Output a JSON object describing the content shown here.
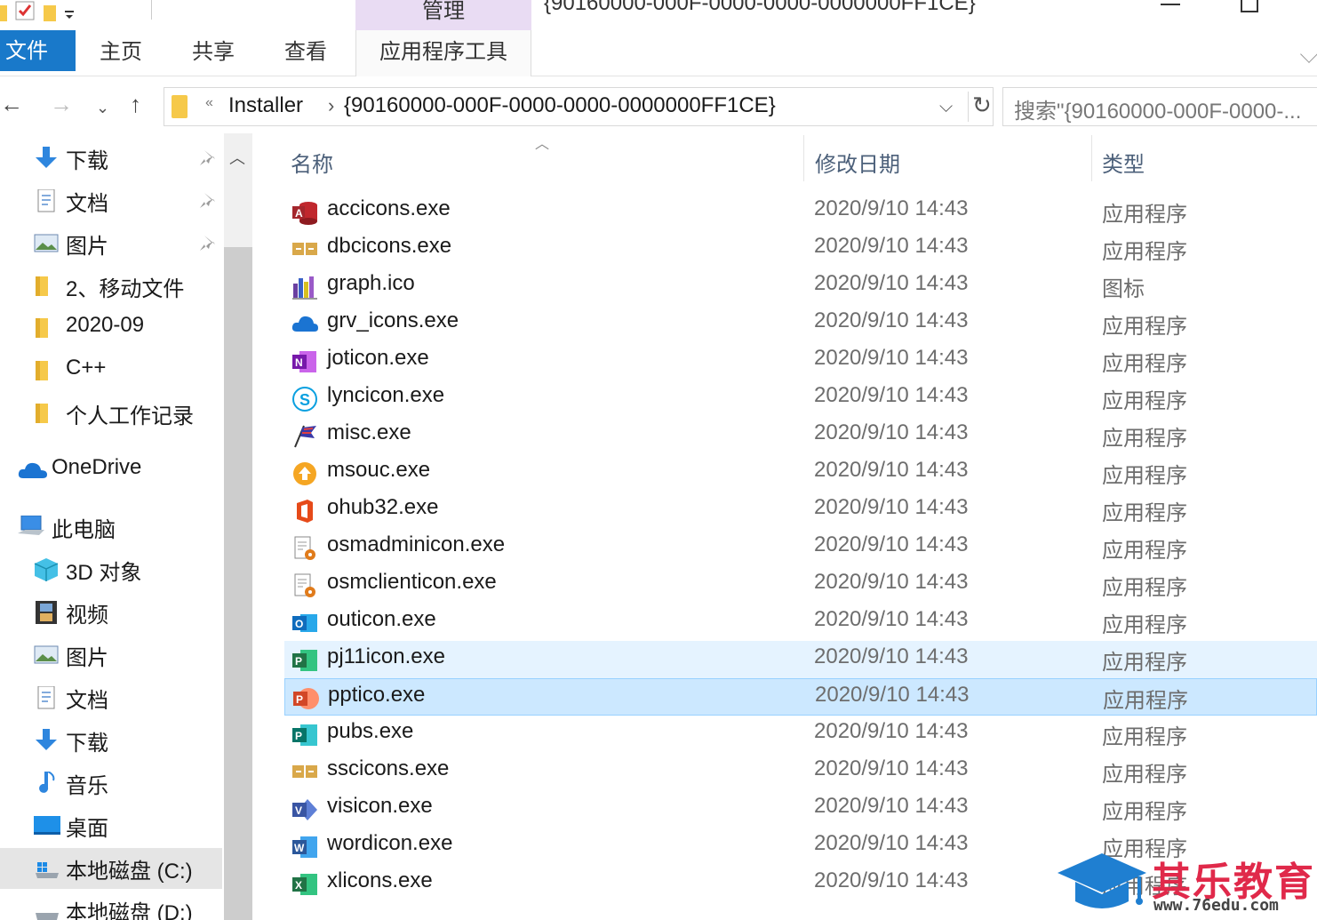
{
  "window": {
    "title": "{90160000-000F-0000-0000-0000000FF1CE}",
    "context_tab_group": "管理"
  },
  "ribbon": {
    "tabs": [
      {
        "label": "文件"
      },
      {
        "label": "主页"
      },
      {
        "label": "共享"
      },
      {
        "label": "查看"
      },
      {
        "label": "应用程序工具"
      }
    ]
  },
  "address": {
    "segments": [
      "Installer",
      "{90160000-000F-0000-0000-0000000FF1CE}"
    ],
    "overflow": "«",
    "separator": "›"
  },
  "search": {
    "placeholder": "搜索\"{90160000-000F-0000-..."
  },
  "nav": {
    "items": [
      {
        "label": "下载",
        "icon": "download-arrow-icon",
        "pinned": true
      },
      {
        "label": "文档",
        "icon": "document-icon",
        "pinned": true
      },
      {
        "label": "图片",
        "icon": "picture-icon",
        "pinned": true
      },
      {
        "label": "2、移动文件",
        "icon": "folder-icon",
        "pinned": false
      },
      {
        "label": "2020-09",
        "icon": "folder-icon",
        "pinned": false
      },
      {
        "label": "C++",
        "icon": "folder-icon",
        "pinned": false
      },
      {
        "label": "个人工作记录",
        "icon": "folder-icon",
        "pinned": false
      },
      {
        "label": "OneDrive",
        "icon": "onedrive-cloud-icon",
        "pinned": false
      },
      {
        "label": "此电脑",
        "icon": "this-pc-icon",
        "pinned": false
      },
      {
        "label": "3D 对象",
        "icon": "3d-objects-icon",
        "pinned": false
      },
      {
        "label": "视频",
        "icon": "video-icon",
        "pinned": false
      },
      {
        "label": "图片",
        "icon": "picture-icon",
        "pinned": false
      },
      {
        "label": "文档",
        "icon": "document-icon",
        "pinned": false
      },
      {
        "label": "下载",
        "icon": "download-arrow-icon",
        "pinned": false
      },
      {
        "label": "音乐",
        "icon": "music-note-icon",
        "pinned": false
      },
      {
        "label": "桌面",
        "icon": "desktop-icon",
        "pinned": false
      },
      {
        "label": "本地磁盘 (C:)",
        "icon": "windows-drive-icon",
        "pinned": false
      },
      {
        "label": "本地磁盘 (D:)",
        "icon": "drive-icon",
        "pinned": false
      }
    ]
  },
  "columns": {
    "name": "名称",
    "date": "修改日期",
    "type": "类型"
  },
  "files": [
    {
      "name": "accicons.exe",
      "date": "2020/9/10 14:43",
      "type": "应用程序",
      "icon": "access-icon",
      "color": "#c0272d"
    },
    {
      "name": "dbcicons.exe",
      "date": "2020/9/10 14:43",
      "type": "应用程序",
      "icon": "dbc-compare-icon",
      "color": "#d9a84a"
    },
    {
      "name": "graph.ico",
      "date": "2020/9/10 14:43",
      "type": "图标",
      "icon": "graph-bars-icon",
      "color": "#6a3fa0"
    },
    {
      "name": "grv_icons.exe",
      "date": "2020/9/10 14:43",
      "type": "应用程序",
      "icon": "onedrive-cloud-icon",
      "color": "#1b74d2"
    },
    {
      "name": "joticon.exe",
      "date": "2020/9/10 14:43",
      "type": "应用程序",
      "icon": "onenote-icon",
      "color": "#7719aa"
    },
    {
      "name": "lyncicon.exe",
      "date": "2020/9/10 14:43",
      "type": "应用程序",
      "icon": "skype-icon",
      "color": "#0aa0e0"
    },
    {
      "name": "misc.exe",
      "date": "2020/9/10 14:43",
      "type": "应用程序",
      "icon": "misc-flag-icon",
      "color": "#3a3aa8"
    },
    {
      "name": "msouc.exe",
      "date": "2020/9/10 14:43",
      "type": "应用程序",
      "icon": "upload-center-icon",
      "color": "#f5a623"
    },
    {
      "name": "ohub32.exe",
      "date": "2020/9/10 14:43",
      "type": "应用程序",
      "icon": "office-hub-icon",
      "color": "#e64a19"
    },
    {
      "name": "osmadminicon.exe",
      "date": "2020/9/10 14:43",
      "type": "应用程序",
      "icon": "doc-gear-icon",
      "color": "#e07b1b"
    },
    {
      "name": "osmclienticon.exe",
      "date": "2020/9/10 14:43",
      "type": "应用程序",
      "icon": "doc-gear-icon",
      "color": "#e07b1b"
    },
    {
      "name": "outicon.exe",
      "date": "2020/9/10 14:43",
      "type": "应用程序",
      "icon": "outlook-icon",
      "color": "#0f6cbd"
    },
    {
      "name": "pj11icon.exe",
      "date": "2020/9/10 14:43",
      "type": "应用程序",
      "icon": "project-icon",
      "color": "#217346"
    },
    {
      "name": "pptico.exe",
      "date": "2020/9/10 14:43",
      "type": "应用程序",
      "icon": "powerpoint-icon",
      "color": "#d24726"
    },
    {
      "name": "pubs.exe",
      "date": "2020/9/10 14:43",
      "type": "应用程序",
      "icon": "publisher-icon",
      "color": "#077568"
    },
    {
      "name": "sscicons.exe",
      "date": "2020/9/10 14:43",
      "type": "应用程序",
      "icon": "ssc-compare-icon",
      "color": "#d9a84a"
    },
    {
      "name": "visicon.exe",
      "date": "2020/9/10 14:43",
      "type": "应用程序",
      "icon": "visio-icon",
      "color": "#3955a3"
    },
    {
      "name": "wordicon.exe",
      "date": "2020/9/10 14:43",
      "type": "应用程序",
      "icon": "word-icon",
      "color": "#2b579a"
    },
    {
      "name": "xlicons.exe",
      "date": "2020/9/10 14:43",
      "type": "应用程序",
      "icon": "excel-icon",
      "color": "#217346"
    }
  ],
  "watermark": {
    "title": "其乐教育",
    "url": "www.76edu.com"
  },
  "colors": {
    "file_tab": "#1979ca",
    "manage_tab": "#e9dcf3",
    "selected_row": "#cce8ff",
    "hover_row": "#e5f3ff",
    "watermark_red": "#e0294a",
    "watermark_blue": "#1f7fd1"
  }
}
